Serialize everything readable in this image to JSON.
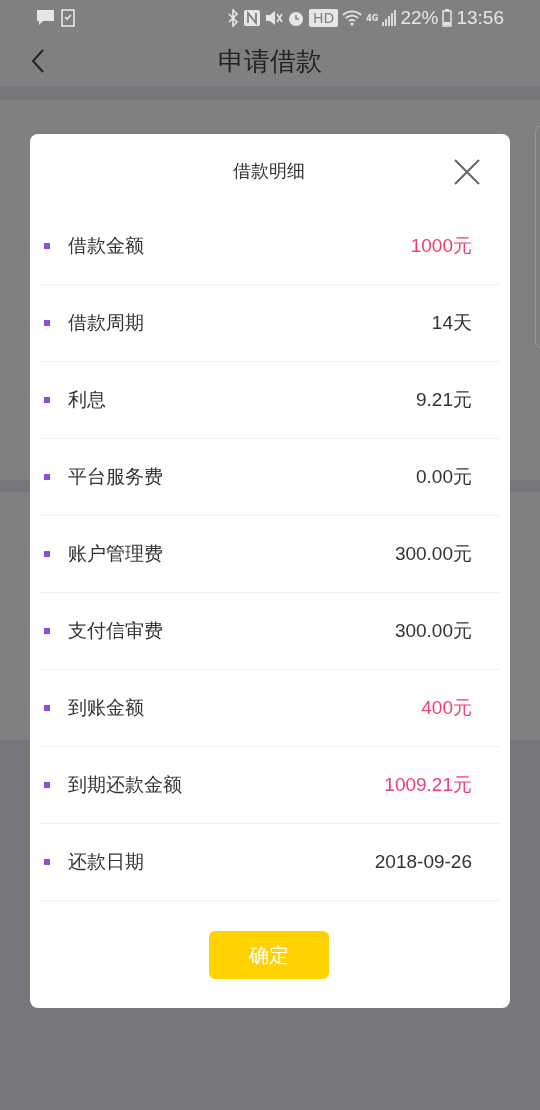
{
  "status_bar": {
    "battery": "22%",
    "time": "13:56",
    "network": "4G",
    "hd_badge": "HD"
  },
  "header": {
    "title": "申请借款"
  },
  "dialog": {
    "title": "借款明细",
    "rows": [
      {
        "label": "借款金额",
        "value": "1000元",
        "highlight": true
      },
      {
        "label": "借款周期",
        "value": "14天",
        "highlight": false
      },
      {
        "label": "利息",
        "value": "9.21元",
        "highlight": false
      },
      {
        "label": "平台服务费",
        "value": "0.00元",
        "highlight": false
      },
      {
        "label": "账户管理费",
        "value": "300.00元",
        "highlight": false
      },
      {
        "label": "支付信审费",
        "value": "300.00元",
        "highlight": false
      },
      {
        "label": "到账金额",
        "value": "400元",
        "highlight": true
      },
      {
        "label": "到期还款金额",
        "value": "1009.21元",
        "highlight": true
      },
      {
        "label": "还款日期",
        "value": "2018-09-26",
        "highlight": false
      }
    ],
    "confirm_button": "确定"
  }
}
